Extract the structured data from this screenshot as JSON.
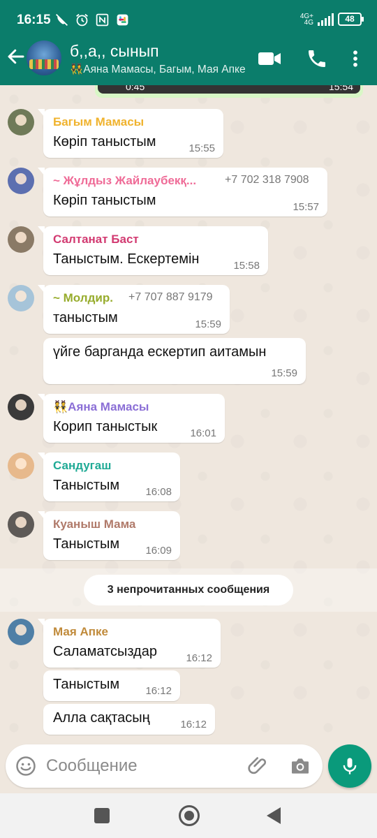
{
  "status_bar": {
    "time": "16:15",
    "network": "4G+",
    "network_sub": "4G",
    "battery": "48",
    "icons": [
      "wifi-calling-off-icon",
      "alarm-icon",
      "nfc-icon",
      "slack-icon"
    ]
  },
  "header": {
    "title": "б,,а,, сынып",
    "members": "👯Аяна Мамасы, Багым, Мая Апке",
    "icons": {
      "back": "arrow-left-icon",
      "video": "video-camera-icon",
      "call": "phone-icon",
      "more": "more-vertical-icon"
    }
  },
  "partial_message": {
    "left": "0:45",
    "time": "15:54"
  },
  "messages": [
    {
      "sender": "Багым Мамасы",
      "sender_color": "#f0b32e",
      "text": "Көріп таныстым",
      "time": "15:55",
      "avatar_color": "#6f7a58"
    },
    {
      "sender": "~ Жұлдыз Жайлаубекқ...",
      "phone": "+7 702 318 7908",
      "sender_color": "#ef6b97",
      "text": "Көріп таныстым",
      "time": "15:57",
      "avatar_color": "#5c6fb0"
    },
    {
      "sender": "Салтанат Баст",
      "sender_color": "#d23a71",
      "text": "Таныстым. Ескертемін",
      "time": "15:58",
      "avatar_color": "#8a7a66"
    },
    {
      "sender": "~ Молдир.",
      "phone": "+7 707 887 9179",
      "sender_color": "#97ac2c",
      "text": "таныстым",
      "time": "15:59",
      "avatar_color": "#a6c4d9"
    },
    {
      "text": "үйге  барганда ескертип аитамын",
      "time": "15:59"
    },
    {
      "sender": "👯Аяна Мамасы",
      "sender_color": "#8b6fd6",
      "text": "Корип таныстык",
      "time": "16:01",
      "avatar_color": "#3a3a3a"
    },
    {
      "sender": "Сандугаш",
      "sender_color": "#1faa95",
      "text": "Таныстым",
      "time": "16:08",
      "avatar_color": "#e7b98c"
    },
    {
      "sender": "Куаныш Мама",
      "sender_color": "#b07a6a",
      "text": "Таныстым",
      "time": "16:09",
      "avatar_color": "#5e5a57"
    },
    {
      "sender": "Мая Апке",
      "sender_color": "#c08a3a",
      "text": "Саламатсыздар",
      "time": "16:12",
      "avatar_color": "#4f7fa6"
    },
    {
      "text": "Таныстым",
      "time": "16:12"
    },
    {
      "text": "Алла сақтасың",
      "time": "16:12"
    }
  ],
  "unread_label": "3 непрочитанных сообщения",
  "composer": {
    "placeholder": "Сообщение",
    "icons": {
      "emoji": "emoji-icon",
      "attach": "paperclip-icon",
      "camera": "camera-icon",
      "mic": "microphone-icon"
    }
  },
  "colors": {
    "header": "#0b7d6b",
    "accent": "#0a9a7b",
    "chat_bg": "#efe7de"
  }
}
